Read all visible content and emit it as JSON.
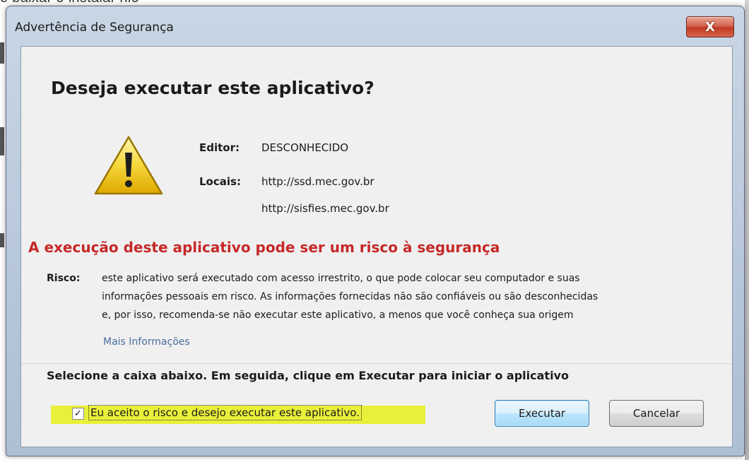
{
  "background": {
    "fragment_text": "e baixar o instalar nio"
  },
  "window": {
    "title": "Advertência de Segurança",
    "close_label": "X"
  },
  "dialog": {
    "heading": "Deseja executar este aplicativo?",
    "icon": "warning-icon",
    "editor_label": "Editor:",
    "editor_value": "DESCONHECIDO",
    "locations_label": "Locais:",
    "locations": [
      "http://ssd.mec.gov.br",
      "http://sisfies.mec.gov.br"
    ],
    "risk_heading": "A execução deste aplicativo pode ser um risco à segurança",
    "risk_label": "Risco:",
    "risk_lines": [
      "este aplicativo será executado com acesso irrestrito, o que pode colocar seu computador e suas",
      "informações pessoais em risco. As informações fornecidas não são confiáveis ou são desconhecidas",
      "e, por isso, recomenda-se não executar este aplicativo, a menos que você conheça sua origem"
    ],
    "more_info_link": "Mais Informações",
    "instruction": "Selecione a caixa abaixo. Em seguida, clique em Executar para iniciar o aplicativo",
    "accept_checkbox": {
      "checked": true,
      "check_glyph": "✓",
      "label": "Eu aceito o risco e desejo executar este aplicativo."
    },
    "buttons": {
      "run": "Executar",
      "cancel": "Cancelar"
    }
  },
  "colors": {
    "risk_heading": "#c62828",
    "link": "#4a6e9b",
    "highlight": "#e8f03a",
    "close_button": "#c23a22"
  }
}
